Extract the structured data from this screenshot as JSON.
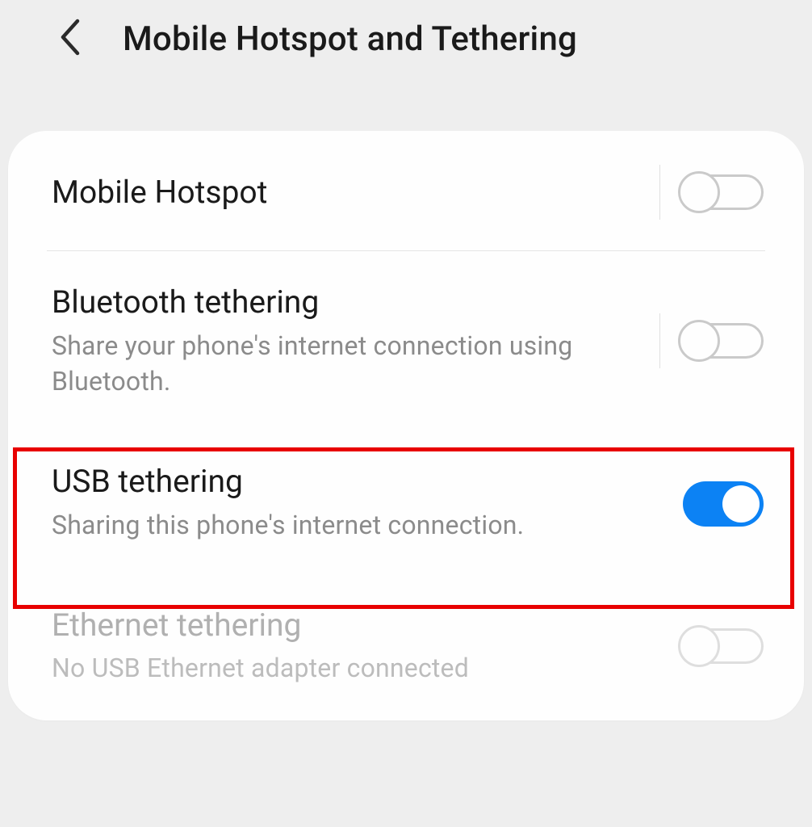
{
  "header": {
    "title": "Mobile Hotspot and Tethering"
  },
  "settings": [
    {
      "title": "Mobile Hotspot",
      "subtitle": "",
      "has_vertical_divider": true,
      "toggle_state": "off",
      "disabled": false,
      "highlighted": false
    },
    {
      "title": "Bluetooth tethering",
      "subtitle": "Share your phone's internet connection using Bluetooth.",
      "has_vertical_divider": true,
      "toggle_state": "off",
      "disabled": false,
      "highlighted": false
    },
    {
      "title": "USB tethering",
      "subtitle": "Sharing this phone's internet connection.",
      "has_vertical_divider": false,
      "toggle_state": "on",
      "disabled": false,
      "highlighted": true
    },
    {
      "title": "Ethernet tethering",
      "subtitle": "No USB Ethernet adapter connected",
      "has_vertical_divider": false,
      "toggle_state": "off",
      "disabled": true,
      "highlighted": false
    }
  ]
}
